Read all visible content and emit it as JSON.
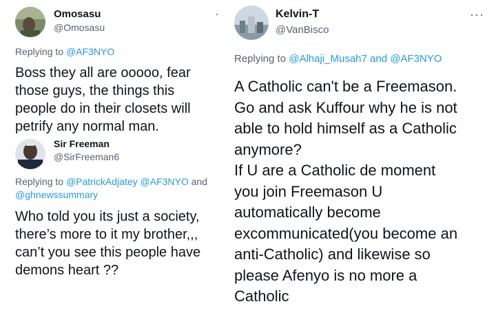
{
  "tweet1": {
    "name": "Omosasu",
    "handle": "@Omosasu",
    "replying_prefix": "Replying to",
    "replying_to": "@AF3NYO",
    "text": "Boss they all are ooooo, fear\nthose guys, the things this\npeople do in their closets will\npetrify any normal man."
  },
  "tweet2": {
    "name": "Sir Freeman",
    "handle": "@SirFreeman6",
    "replying_prefix": "Replying to",
    "replying_line1_links": "@PatrickAdjatey @AF3NYO",
    "replying_and": "and",
    "replying_line2_link": "@ghnewssummary",
    "text": "Who told you its just a society,\nthere’s more to it my brother,,,\ncan’t you see this people have\ndemons heart ??"
  },
  "tweet3": {
    "name": "Kelvin-T",
    "handle": "@VanBisco",
    "more": "···",
    "replying_prefix": "Replying to",
    "replying_link1": "@Alhaji_Musah7",
    "replying_and": "and",
    "replying_link2": "@AF3NYO",
    "text": "A Catholic can't be a Freemason.\nGo and ask Kuffour why he is not\nable to hold himself as a Catholic\nanymore?\nIf U are a Catholic de moment\nyou join Freemason U\nautomatically become\nexcommunicated(you become an\nanti-Catholic) and likewise so\nplease Afenyo is no more a\nCatholic"
  },
  "colors": {
    "text": "#0f1419",
    "secondary": "#536471",
    "link": "#1d9bf0"
  }
}
